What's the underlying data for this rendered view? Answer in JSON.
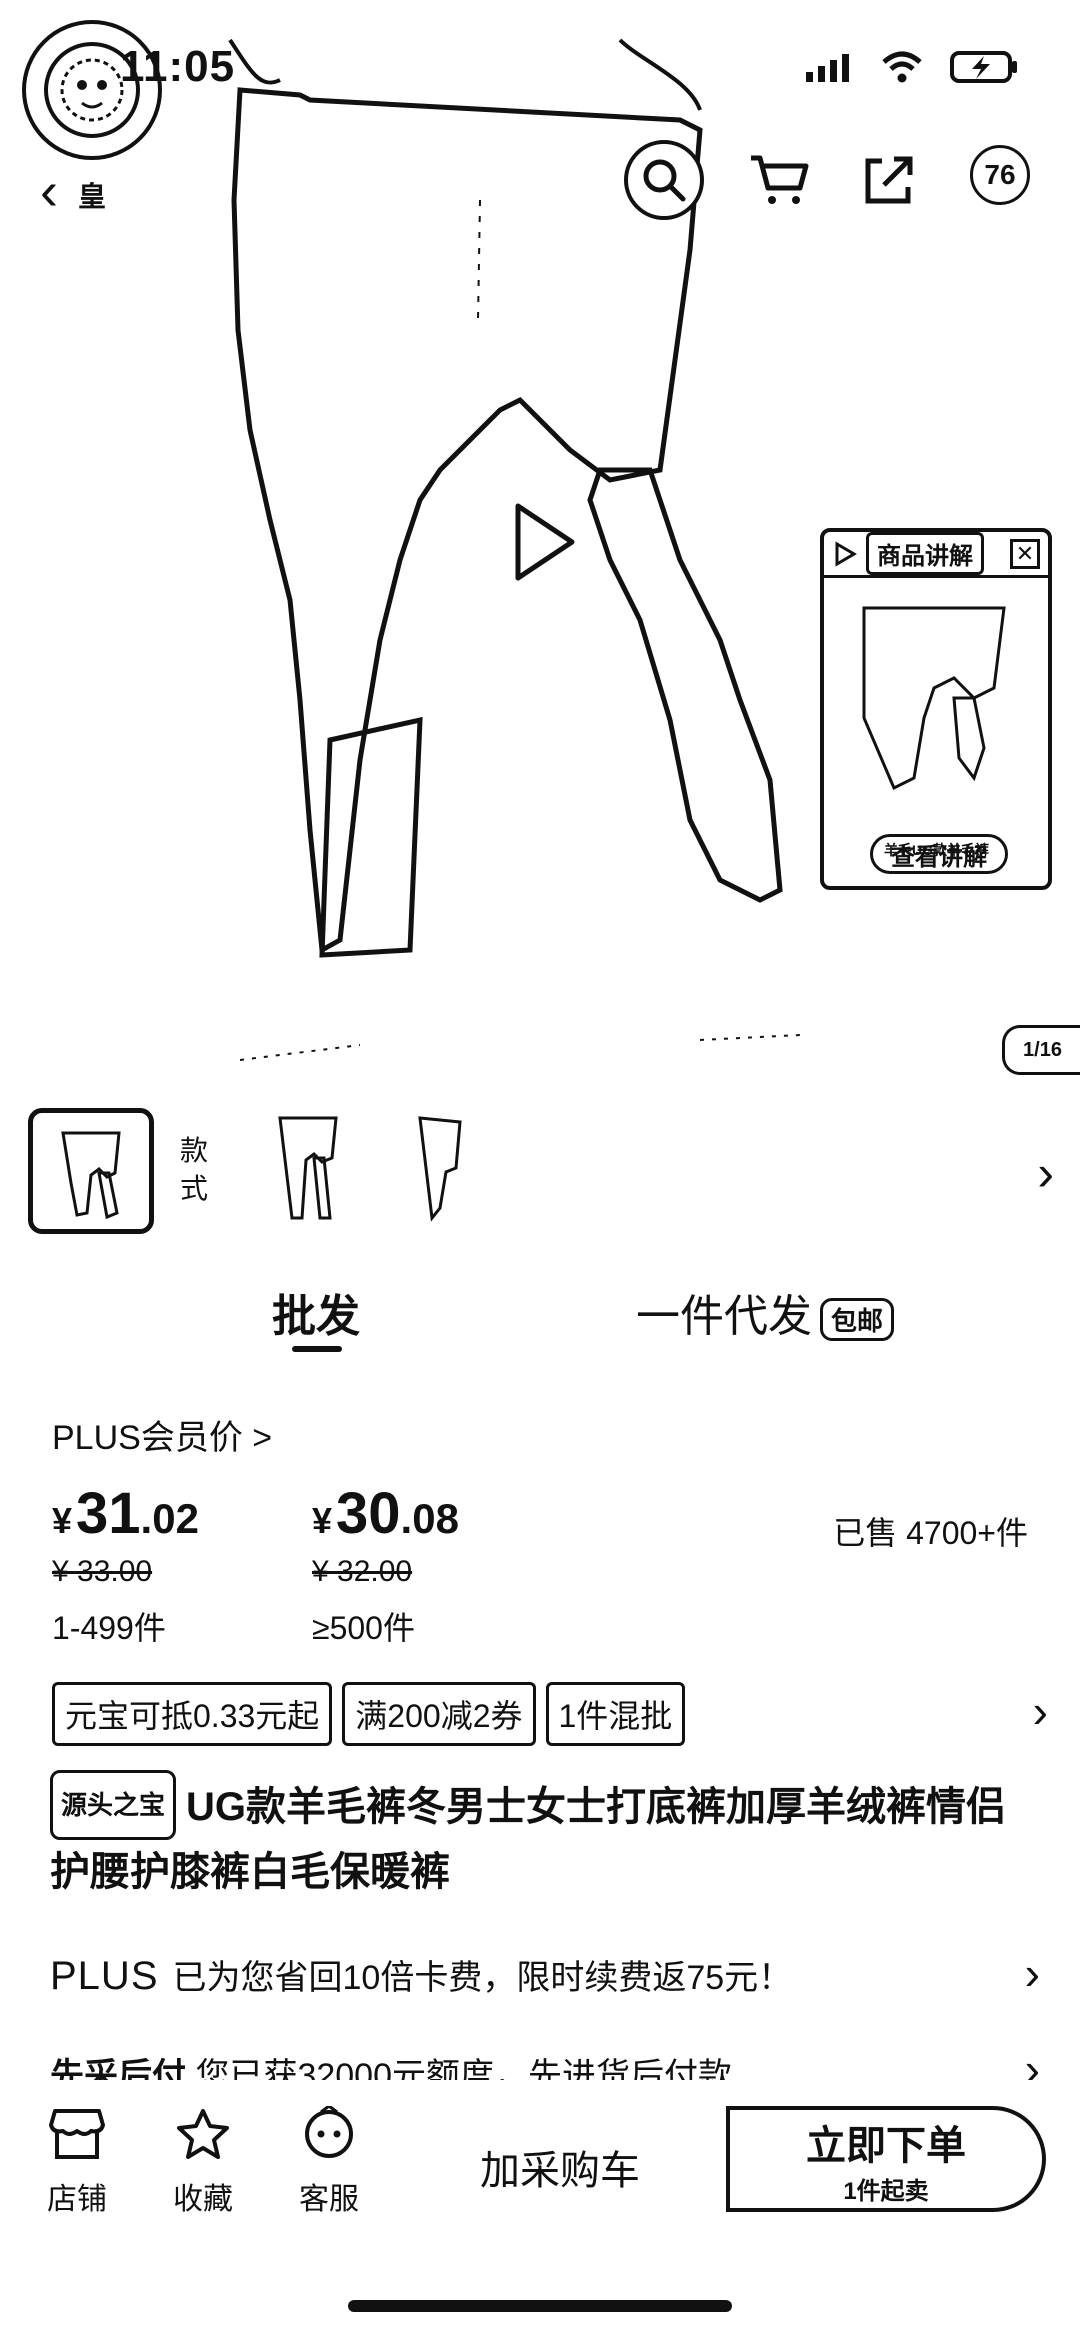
{
  "status_bar": {
    "time": "11:05"
  },
  "shop_logo_text": "皇",
  "explain_card": {
    "title": "商品讲解",
    "caption": "羊毛UG款羊毛裤",
    "button": "查看讲解"
  },
  "gallery": {
    "page_indicator": "1/16",
    "style_label": "款式"
  },
  "cart_badge": "76",
  "tabs": {
    "wholesale": "批发",
    "dropship": "一件代发",
    "free_shipping": "包邮"
  },
  "plus_price_label": "PLUS会员价 >",
  "prices": [
    {
      "yen": "¥",
      "int": "31",
      "dec": ".02",
      "old": "¥ 33.00",
      "range": "1-499件"
    },
    {
      "yen": "¥",
      "int": "30",
      "dec": ".08",
      "old": "¥ 32.00",
      "range": "≥500件"
    }
  ],
  "sold": "已售 4700+件",
  "promos": [
    "元宝可抵0.33元起",
    "满200减2券",
    "1件混批"
  ],
  "product": {
    "brand_tag": "源头之宝",
    "title": "UG款羊毛裤冬男士女士打底裤加厚羊绒裤情侣护腰护膝裤白毛保暖裤"
  },
  "plus_row": {
    "logo": "PLUS",
    "text": "已为您省回10倍卡费，限时续费返75元！"
  },
  "credit_row": {
    "title": "先采后付",
    "text": "您已获32000元额度，先进货后付款"
  },
  "bottom_bar": {
    "shop": "店铺",
    "favorite": "收藏",
    "service": "客服",
    "add_cart": "加采购车",
    "buy_now": "立即下单",
    "buy_now_sub": "1件起卖"
  }
}
